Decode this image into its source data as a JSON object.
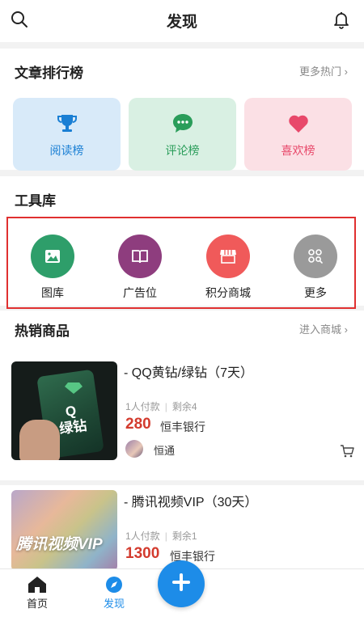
{
  "header": {
    "title": "发现",
    "search_icon": "search-icon",
    "bell_icon": "bell-icon"
  },
  "articles": {
    "title": "文章排行榜",
    "more": "更多热门",
    "cards": [
      {
        "label": "阅读榜",
        "icon": "trophy-icon",
        "bg": "#d8eaf9",
        "color": "#1a7fd4"
      },
      {
        "label": "评论榜",
        "icon": "chat-icon",
        "bg": "#d9f0e3",
        "color": "#2a9d5a"
      },
      {
        "label": "喜欢榜",
        "icon": "heart-icon",
        "bg": "#fbe0e5",
        "color": "#e8486a"
      }
    ]
  },
  "tools": {
    "title": "工具库",
    "items": [
      {
        "label": "图库",
        "icon": "image-icon",
        "color": "#2e9e6a"
      },
      {
        "label": "广告位",
        "icon": "book-icon",
        "color": "#8e3d7e"
      },
      {
        "label": "积分商城",
        "icon": "shop-icon",
        "color": "#f05a5a"
      },
      {
        "label": "更多",
        "icon": "more-icon",
        "color": "#9a9a9a"
      }
    ]
  },
  "hot": {
    "title": "热销商品",
    "more": "进入商城",
    "products": [
      {
        "title": "- QQ黄钻/绿钻（7天）",
        "buyers": "1人付款",
        "remain": "剩余4",
        "price": "280",
        "unit": "恒丰银行",
        "user": "恒通",
        "thumb_text": "Q\n绿钻"
      },
      {
        "title": "- 腾讯视频VIP（30天）",
        "buyers": "1人付款",
        "remain": "剩余1",
        "price": "1300",
        "unit": "恒丰银行",
        "thumb_text": "腾讯视频VIP"
      }
    ]
  },
  "tabbar": {
    "items": [
      {
        "label": "首页",
        "icon": "home-icon",
        "active": false
      },
      {
        "label": "发现",
        "icon": "compass-icon",
        "active": true
      }
    ],
    "add_icon": "plus-icon"
  },
  "colors": {
    "accent": "#1d8ce8",
    "price": "#d33b2e",
    "highlight_border": "#e03030"
  }
}
